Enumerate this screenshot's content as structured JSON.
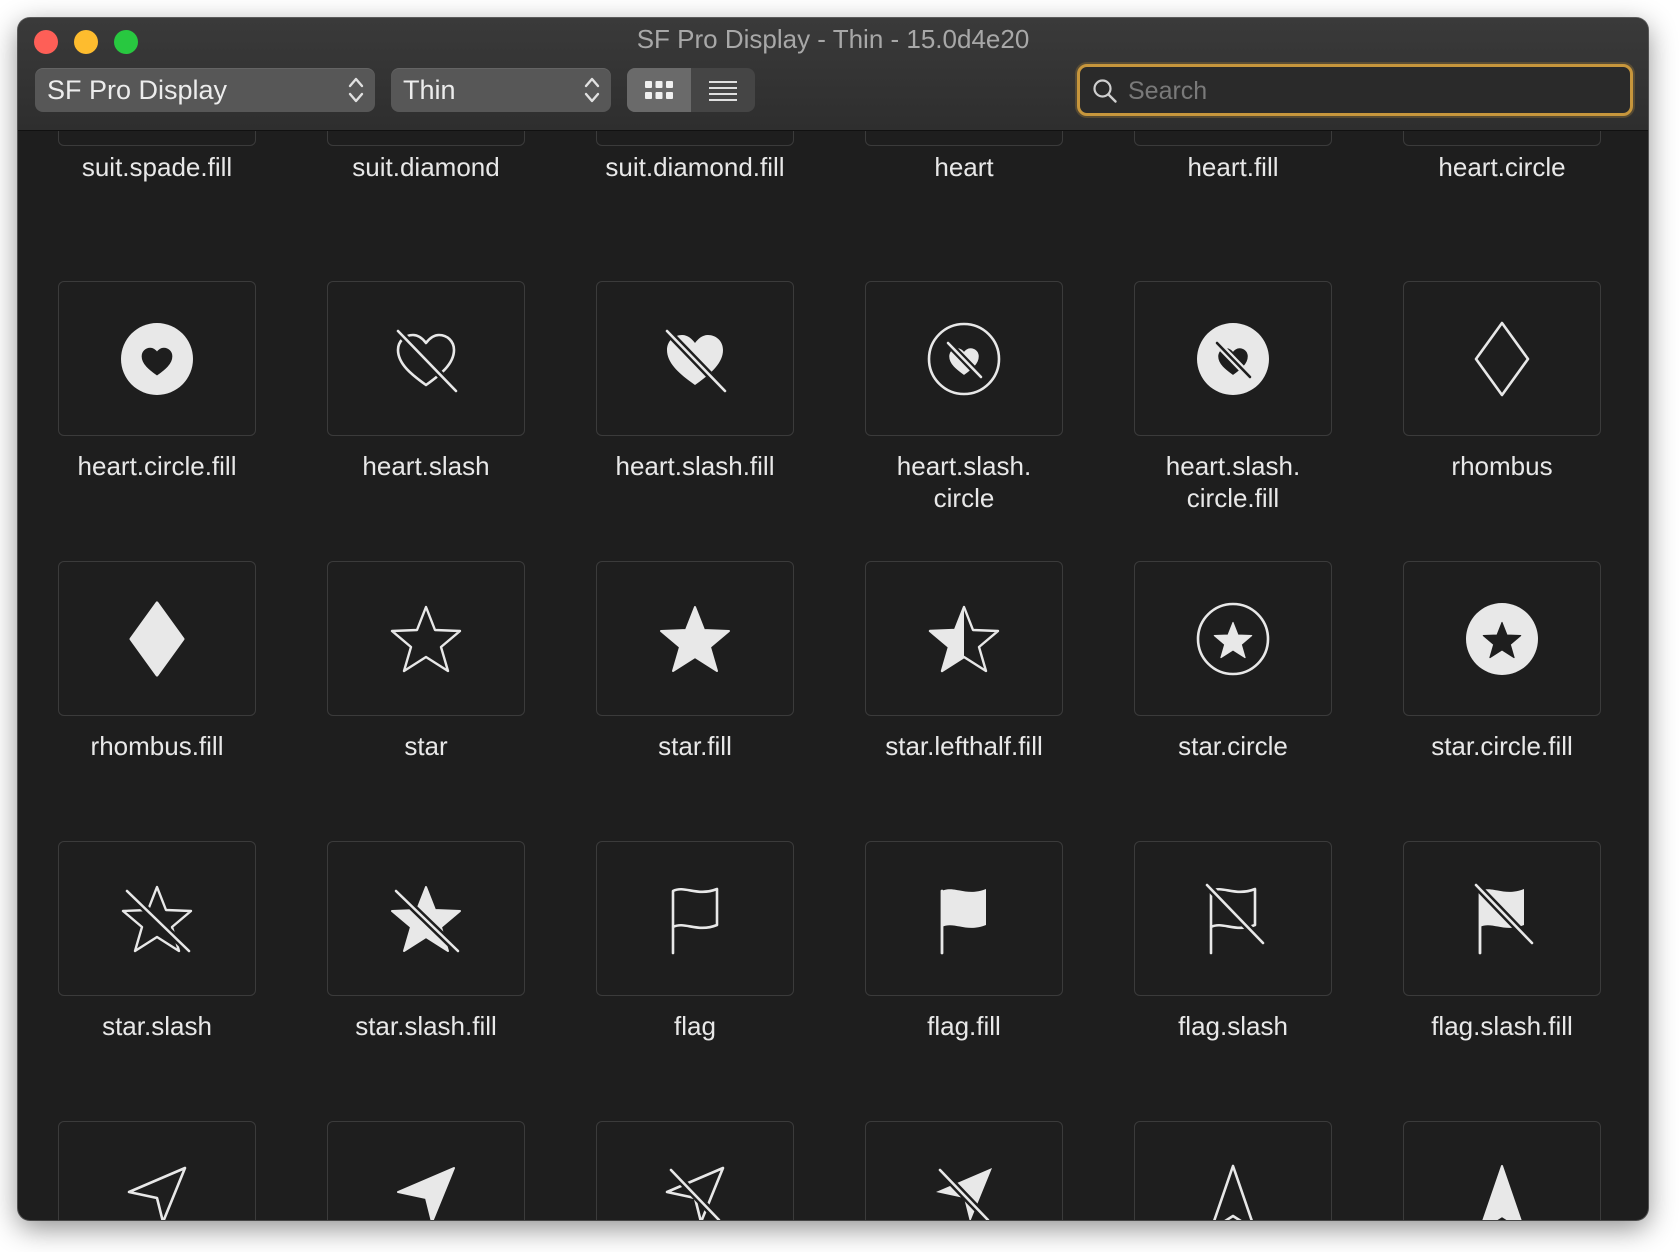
{
  "window": {
    "title": "SF Pro Display - Thin - 15.0d4e20",
    "traffic_lights": [
      "close-button",
      "minimize-button",
      "zoom-button"
    ]
  },
  "toolbar": {
    "font_family": "SF Pro Display",
    "font_weight": "Thin",
    "view_modes": [
      "grid-view-icon",
      "list-view-icon"
    ],
    "active_view": "grid",
    "search_placeholder": "Search",
    "search_value": "",
    "search_focus_color": "#c7963c"
  },
  "symbols": {
    "partial_top_row": [
      "suit.spade.fill",
      "suit.diamond",
      "suit.diamond.fill",
      "heart",
      "heart.fill",
      "heart.circle"
    ],
    "rows": [
      [
        {
          "name": "heart.circle.fill",
          "icon": "heart-circle-fill-icon"
        },
        {
          "name": "heart.slash",
          "icon": "heart-slash-icon"
        },
        {
          "name": "heart.slash.fill",
          "icon": "heart-slash-fill-icon"
        },
        {
          "name": "heart.slash.\ncircle",
          "icon": "heart-slash-circle-icon"
        },
        {
          "name": "heart.slash.\ncircle.fill",
          "icon": "heart-slash-circle-fill-icon"
        },
        {
          "name": "rhombus",
          "icon": "rhombus-icon"
        }
      ],
      [
        {
          "name": "rhombus.fill",
          "icon": "rhombus-fill-icon"
        },
        {
          "name": "star",
          "icon": "star-icon"
        },
        {
          "name": "star.fill",
          "icon": "star-fill-icon"
        },
        {
          "name": "star.lefthalf.fill",
          "icon": "star-lefthalf-fill-icon"
        },
        {
          "name": "star.circle",
          "icon": "star-circle-icon"
        },
        {
          "name": "star.circle.fill",
          "icon": "star-circle-fill-icon"
        }
      ],
      [
        {
          "name": "star.slash",
          "icon": "star-slash-icon"
        },
        {
          "name": "star.slash.fill",
          "icon": "star-slash-fill-icon"
        },
        {
          "name": "flag",
          "icon": "flag-icon"
        },
        {
          "name": "flag.fill",
          "icon": "flag-fill-icon"
        },
        {
          "name": "flag.slash",
          "icon": "flag-slash-icon"
        },
        {
          "name": "flag.slash.fill",
          "icon": "flag-slash-fill-icon"
        }
      ]
    ],
    "partial_bottom_row_icons": [
      "location-icon",
      "location-fill-icon",
      "location-slash-icon",
      "location-slash-fill-icon",
      "location-north-icon",
      "location-north-fill-icon"
    ]
  },
  "colors": {
    "window_bg": "#1e1e1e",
    "tile_border": "#3b3b3b",
    "glyph": "#e8e8e8",
    "label": "#e8e8e8"
  }
}
